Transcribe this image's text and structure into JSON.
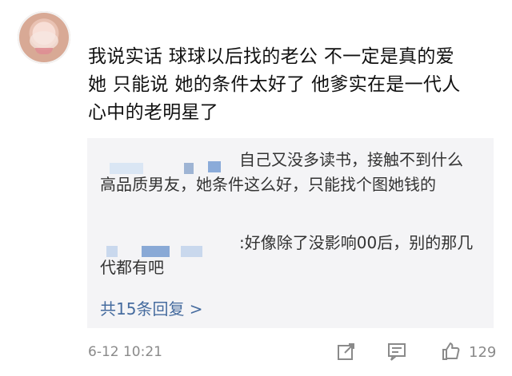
{
  "comment": {
    "text_lines": [
      "我说实话 球球以后找的老公 不一定是真的爱",
      "她 只能说 她的条件太好了 他爹实在是一代人",
      "心中的老明星了"
    ]
  },
  "replies": [
    {
      "text": "自己又没多读书，接触不到什么高品质男友，她条件这么好，只能找个图她钱的"
    },
    {
      "prefix": ":",
      "text": "好像除了没影响00后，别的那几代都有吧"
    }
  ],
  "reply_summary": {
    "label": "共15条回复 >"
  },
  "footer": {
    "date": "6-12 10:21",
    "like_count": "129",
    "icons": [
      "share-icon",
      "comment-icon",
      "like-icon"
    ]
  },
  "colors": {
    "reply_bg": "#f4f4f6",
    "link": "#466c9f",
    "meta_gray": "#8a8a8a"
  }
}
